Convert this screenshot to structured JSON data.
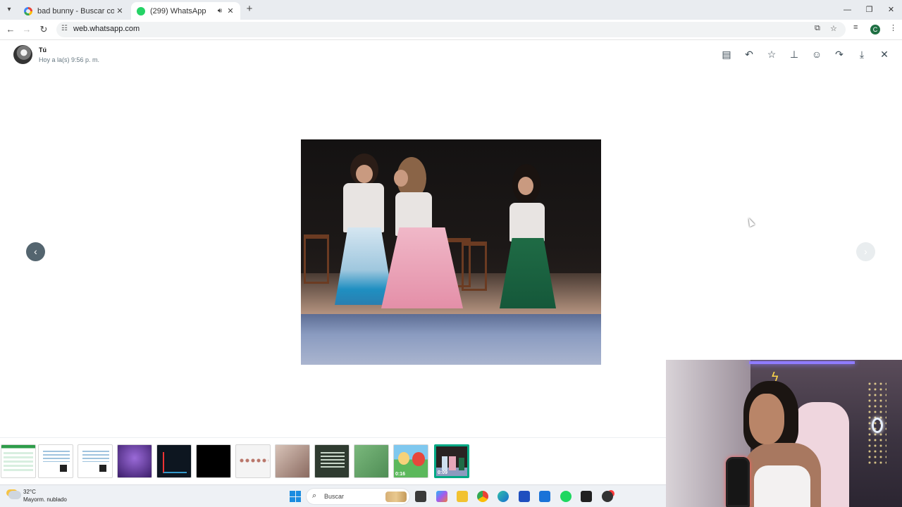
{
  "browser": {
    "tabs": [
      {
        "title": "bad bunny - Buscar con Google",
        "active": false,
        "favicon": "google-icon"
      },
      {
        "title": "(299) WhatsApp",
        "active": true,
        "favicon": "whatsapp-icon",
        "audio": true
      }
    ],
    "url": "web.whatsapp.com",
    "profile_initial": "C"
  },
  "viewer": {
    "sender": "Tú",
    "timestamp": "Hoy a la(s) 9:56 p. m.",
    "actions": [
      "message-icon",
      "reply-icon",
      "star-icon",
      "pin-icon",
      "emoji-icon",
      "forward-icon",
      "download-icon",
      "close-icon"
    ]
  },
  "thumbnails": [
    {
      "kind": "spreadsheet",
      "color": "#2e9d4a"
    },
    {
      "kind": "document-qr",
      "color": "#ffffff"
    },
    {
      "kind": "document-qr",
      "color": "#ffffff"
    },
    {
      "kind": "photo-purple",
      "color": "#4b2b7a"
    },
    {
      "kind": "dark-chart",
      "color": "#101820"
    },
    {
      "kind": "black",
      "color": "#000000"
    },
    {
      "kind": "document-faces",
      "color": "#f4f4f4"
    },
    {
      "kind": "photo-woman",
      "color": "#9b8079"
    },
    {
      "kind": "poster-dark",
      "color": "#2a3a2a"
    },
    {
      "kind": "photo-green",
      "color": "#5f9c63"
    },
    {
      "kind": "video-cartoon",
      "color": "#5cb85c",
      "duration": "0:16"
    },
    {
      "kind": "video-stage",
      "color": "#2a2322",
      "duration": "0:09",
      "selected": true
    }
  ],
  "taskbar": {
    "temperature": "32°C",
    "condition": "Mayorm. nublado",
    "search_placeholder": "Buscar"
  }
}
